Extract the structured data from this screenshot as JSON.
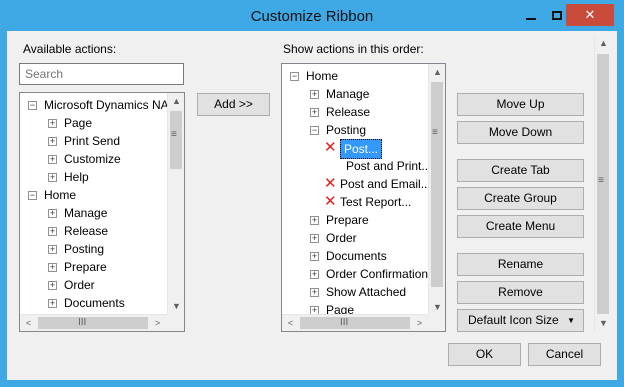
{
  "window": {
    "title": "Customize Ribbon",
    "minimize_glyph": "—",
    "close_glyph": "✕"
  },
  "available": {
    "label": "Available actions:",
    "search_placeholder": "Search",
    "items": [
      {
        "label": "Microsoft Dynamics NA",
        "expander": "−",
        "level": 0
      },
      {
        "label": "Page",
        "expander": "+",
        "level": 1
      },
      {
        "label": "Print  Send",
        "expander": "+",
        "level": 1
      },
      {
        "label": "Customize",
        "expander": "+",
        "level": 1
      },
      {
        "label": "Help",
        "expander": "+",
        "level": 1
      },
      {
        "label": "Home",
        "expander": "−",
        "level": 0
      },
      {
        "label": "Manage",
        "expander": "+",
        "level": 1
      },
      {
        "label": "Release",
        "expander": "+",
        "level": 1
      },
      {
        "label": "Posting",
        "expander": "+",
        "level": 1
      },
      {
        "label": "Prepare",
        "expander": "+",
        "level": 1
      },
      {
        "label": "Order",
        "expander": "+",
        "level": 1
      },
      {
        "label": "Documents",
        "expander": "+",
        "level": 1
      }
    ]
  },
  "add_button": "Add >>",
  "show": {
    "label": "Show actions in this order:",
    "items": [
      {
        "label": "Home",
        "expander": "−",
        "level": 0
      },
      {
        "label": "Manage",
        "expander": "+",
        "level": 1
      },
      {
        "label": "Release",
        "expander": "+",
        "level": 1
      },
      {
        "label": "Posting",
        "expander": "−",
        "level": 1
      },
      {
        "label": "Post...",
        "expander": "",
        "level": 2,
        "xmark": true,
        "selected": true
      },
      {
        "label": "Post and Print...",
        "expander": "",
        "level": 2
      },
      {
        "label": "Post and Email...",
        "expander": "",
        "level": 2,
        "xmark": true
      },
      {
        "label": "Test Report...",
        "expander": "",
        "level": 2,
        "xmark": true
      },
      {
        "label": "Prepare",
        "expander": "+",
        "level": 1
      },
      {
        "label": "Order",
        "expander": "+",
        "level": 1
      },
      {
        "label": "Documents",
        "expander": "+",
        "level": 1
      },
      {
        "label": "Order Confirmation",
        "expander": "+",
        "level": 1
      },
      {
        "label": "Show Attached",
        "expander": "+",
        "level": 1
      },
      {
        "label": "Page",
        "expander": "+",
        "level": 1
      }
    ]
  },
  "buttons": {
    "move_up": "Move Up",
    "move_down": "Move Down",
    "create_tab": "Create Tab",
    "create_group": "Create Group",
    "create_menu": "Create Menu",
    "rename": "Rename",
    "remove": "Remove",
    "default_icon_size": "Default Icon Size",
    "ok": "OK",
    "cancel": "Cancel"
  },
  "glyphs": {
    "up": "▲",
    "down": "▼",
    "left": "<",
    "right": ">",
    "grip_v": "≡",
    "grip_h": "III",
    "dropdown": "▼",
    "delete": "✕"
  },
  "colors": {
    "titlebar": "#3fa9e6",
    "close": "#c84b3c",
    "selection": "#3399ff",
    "delete_mark": "#e02020"
  }
}
